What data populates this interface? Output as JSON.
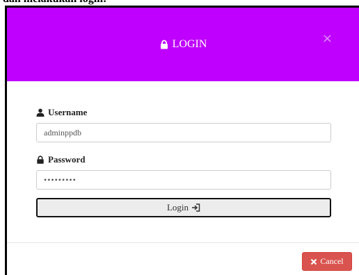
{
  "caption": "dan melakukan login:",
  "colors": {
    "header_bg": "#bf00ff",
    "cancel_bg": "#d9534f",
    "login_bg": "#ececec"
  },
  "modal": {
    "title": "LOGIN",
    "title_icon": "lock-icon",
    "close_symbol": "×",
    "username": {
      "label": "Username",
      "icon": "user-icon",
      "value": "adminppdb"
    },
    "password": {
      "label": "Password",
      "icon": "lock-icon",
      "value": "•••••••••"
    },
    "login_button": {
      "label": "Login",
      "icon": "sign-in-icon"
    },
    "cancel_button": {
      "label": "Cancel",
      "icon": "times-icon"
    }
  }
}
